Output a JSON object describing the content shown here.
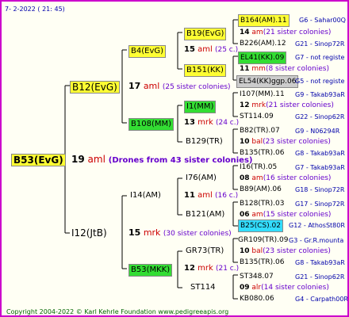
{
  "header": "7-  2-2022 ( 21: 45)",
  "root": {
    "label": "B53(EvG)",
    "count": "19",
    "gene": "aml",
    "note": "(Drones from 43 sister colonies)"
  },
  "gen1": [
    {
      "label": "B12(EvG)",
      "count": "17",
      "gene": "aml",
      "note": "(25 sister colonies)"
    },
    {
      "label": "I12(JtB)",
      "count": "15",
      "gene": "mrk",
      "note": "(30 sister colonies)"
    }
  ],
  "gen2": [
    {
      "label": "B4(EvG)",
      "count": "15",
      "gene": "aml",
      "note": "(25 c.)"
    },
    {
      "label": "B108(MM)",
      "count": "13",
      "gene": "mrk",
      "note": "(24 c.)"
    },
    {
      "label": "I14(AM)",
      "count": "11",
      "gene": "aml",
      "note": "(16 c.)"
    },
    {
      "label": "B53(MKK)",
      "count": "12",
      "gene": "mrk",
      "note": "(21 c.)"
    }
  ],
  "gen3": [
    {
      "label": "B19(EvG)",
      "count": "14",
      "gene": "am",
      "note": "(21 sister colonies)"
    },
    {
      "label": "B151(KK)",
      "count": "11",
      "gene": "mm",
      "note": "(8 sister colonies)"
    },
    {
      "label": "I1(MM)",
      "count": "12",
      "gene": "mrk",
      "note": "(21 sister colonies)"
    },
    {
      "label": "B129(TR)",
      "count": "10",
      "gene": "bal",
      "note": "(23 sister colonies)"
    },
    {
      "label": "I76(AM)",
      "count": "08",
      "gene": "am",
      "note": "(16 sister colonies)"
    },
    {
      "label": "B121(AM)",
      "count": "06",
      "gene": "am",
      "note": "(15 sister colonies)"
    },
    {
      "label": "GR73(TR)",
      "count": "10",
      "gene": "bal",
      "note": "(23 sister colonies)"
    },
    {
      "label": "ST114",
      "count": "09",
      "gene": "alr",
      "note": "(14 sister colonies)"
    }
  ],
  "gen4": [
    {
      "label": "B164(AM).11",
      "info": "G6 - Sahar00Q"
    },
    {
      "label": "B226(AM).12",
      "info": "G21 - Sinop72R"
    },
    {
      "label": "EL41(KK).09",
      "info": "G7 - not registe"
    },
    {
      "label": "EL54(KK)ggp.06",
      "info": "G5 - not registe"
    },
    {
      "label": "I107(MM).11",
      "info": "G9 - Takab93aR"
    },
    {
      "label": "ST114.09",
      "info": "G22 - Sinop62R"
    },
    {
      "label": "B82(TR).07",
      "info": "G9 - N06294R"
    },
    {
      "label": "B135(TR).06",
      "info": "G8 - Takab93aR"
    },
    {
      "label": "I16(TR).05",
      "info": "G7 - Takab93aR"
    },
    {
      "label": "B89(AM).06",
      "info": "G18 - Sinop72R"
    },
    {
      "label": "B128(TR).03",
      "info": "G17 - Sinop72R"
    },
    {
      "label": "B25(CS).02",
      "info": "G12 - AthosSt80R"
    },
    {
      "label": "GR109(TR).09",
      "info": "G3 - Gr.R.mounta"
    },
    {
      "label": "B135(TR).06",
      "info": "G8 - Takab93aR"
    },
    {
      "label": "ST348.07",
      "info": "G21 - Sinop62R"
    },
    {
      "label": "KB080.06",
      "info": "G4 - Carpath00R"
    }
  ],
  "footer": "Copyright 2004-2022 © Karl Kehrle Foundation    www.pedigreeapis.org"
}
